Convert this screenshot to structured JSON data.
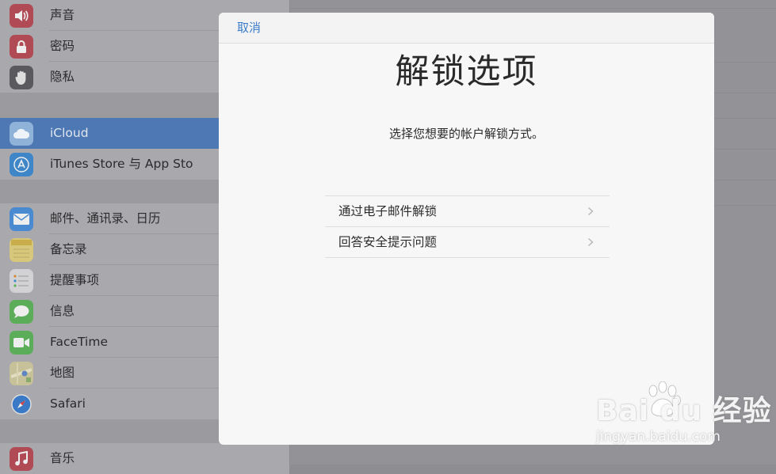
{
  "sidebar": {
    "items": [
      {
        "label": "声音",
        "icon": "speaker-icon",
        "color": "#b04a55"
      },
      {
        "label": "密码",
        "icon": "lock-icon",
        "color": "#b04a55"
      },
      {
        "label": "隐私",
        "icon": "hand-icon",
        "color": "#5a5a5e"
      },
      {
        "label": "iCloud",
        "icon": "cloud-icon",
        "color": "#8fb2d9",
        "active": true
      },
      {
        "label": "iTunes Store 与 App Sto",
        "icon": "app-store-icon",
        "color": "#3f86c8"
      },
      {
        "label": "邮件、通讯录、日历",
        "icon": "mail-icon",
        "color": "#4a8ad0"
      },
      {
        "label": "备忘录",
        "icon": "notes-icon",
        "color": "#d7c77a"
      },
      {
        "label": "提醒事项",
        "icon": "reminders-icon",
        "color": "#d2d2d4"
      },
      {
        "label": "信息",
        "icon": "messages-icon",
        "color": "#5cad5a"
      },
      {
        "label": "FaceTime",
        "icon": "facetime-icon",
        "color": "#5cad5a"
      },
      {
        "label": "地图",
        "icon": "maps-icon",
        "color": "#c7c19a"
      },
      {
        "label": "Safari",
        "icon": "compass-icon",
        "color": "#3a79c5"
      },
      {
        "label": "音乐",
        "icon": "music-icon",
        "color": "#b04a55"
      }
    ]
  },
  "modal": {
    "cancel_label": "取消",
    "title": "解锁选项",
    "subtitle": "选择您想要的帐户解锁方式。",
    "options": [
      {
        "label": "通过电子邮件解锁"
      },
      {
        "label": "回答安全提示问题"
      }
    ]
  },
  "watermark": {
    "brand": "Bai du 经验",
    "url": "jingyan.baidu.com"
  },
  "colors": {
    "accent": "#3b7cc9",
    "active_row": "#4d78b3"
  }
}
